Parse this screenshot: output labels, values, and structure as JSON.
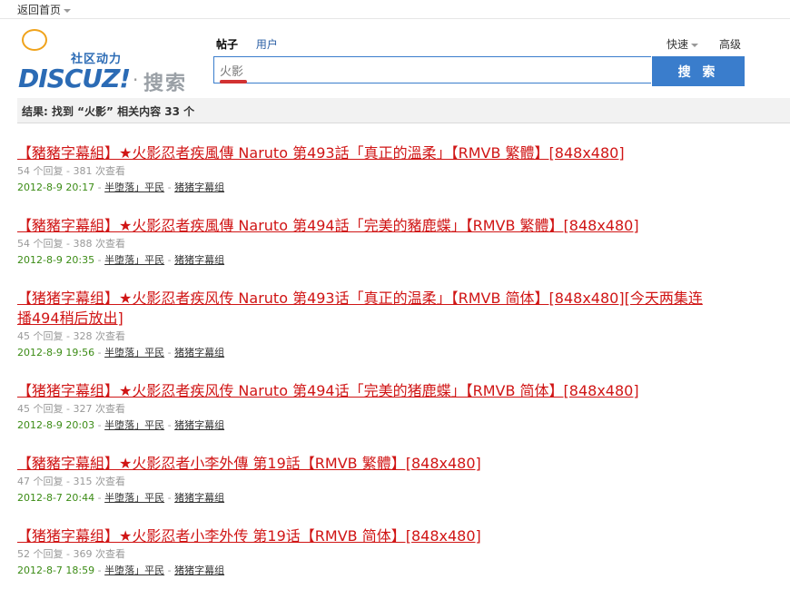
{
  "topbar": {
    "back_label": "返回首页"
  },
  "logo": {
    "tagline": "社区动力",
    "brand": "DISCUZ!",
    "dot": "·",
    "product": "搜索"
  },
  "tabs": [
    {
      "label": "帖子",
      "active": true
    },
    {
      "label": "用户",
      "active": false
    }
  ],
  "quick_label": "快速",
  "advanced_label": "高级",
  "search": {
    "value": "火影",
    "button_label": "搜 索"
  },
  "result_summary": "结果: 找到 “火影” 相关内容 33 个",
  "results": [
    {
      "title": "【豬豬字幕組】★火影忍者疾風傳 Naruto 第493話「真正的溫柔」【RMVB 繁體】[848x480]",
      "stats": "54 个回复 - 381 次查看",
      "date": "2012-8-9 20:17",
      "author": "半堕落」平民",
      "forum": "猪猪字幕组"
    },
    {
      "title": "【豬豬字幕組】★火影忍者疾風傳 Naruto 第494話「完美的豬鹿蝶」【RMVB 繁體】[848x480]",
      "stats": "54 个回复 - 388 次查看",
      "date": "2012-8-9 20:35",
      "author": "半堕落」平民",
      "forum": "猪猪字幕组"
    },
    {
      "title": "【猪猪字幕组】★火影忍者疾风传 Naruto 第493话「真正的温柔」【RMVB 简体】[848x480][今天两集连播494稍后放出]",
      "stats": "45 个回复 - 328 次查看",
      "date": "2012-8-9 19:56",
      "author": "半堕落」平民",
      "forum": "猪猪字幕组"
    },
    {
      "title": "【猪猪字幕组】★火影忍者疾风传 Naruto 第494话「完美的猪鹿蝶」【RMVB 简体】[848x480]",
      "stats": "45 个回复 - 327 次查看",
      "date": "2012-8-9 20:03",
      "author": "半堕落」平民",
      "forum": "猪猪字幕组"
    },
    {
      "title": "【豬豬字幕組】★火影忍者小李外傳 第19話【RMVB 繁體】[848x480]",
      "stats": "47 个回复 - 315 次查看",
      "date": "2012-8-7 20:44",
      "author": "半堕落」平民",
      "forum": "猪猪字幕组"
    },
    {
      "title": "【猪猪字幕组】★火影忍者小李外传 第19话【RMVB 简体】[848x480]",
      "stats": "52 个回复 - 369 次查看",
      "date": "2012-8-7 18:59",
      "author": "半堕落」平民",
      "forum": "猪猪字幕组"
    }
  ],
  "colors": {
    "accent": "#3a7dcc",
    "title_red": "#d01515",
    "date_green": "#3c8c16"
  }
}
